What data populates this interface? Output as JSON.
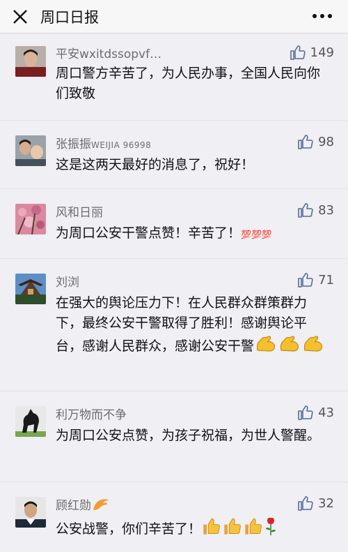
{
  "header": {
    "title": "周口日报"
  },
  "comments": [
    {
      "name": "平安wxitdssopvf…",
      "likes": "149",
      "text": "周口警方辛苦了，为人民办事，全国人民向你们致敬"
    },
    {
      "name": "张振振",
      "name_suffix": "WEIJIA 96998",
      "likes": "98",
      "text": "这是这两天最好的消息了，祝好！"
    },
    {
      "name": "风和日丽",
      "likes": "83",
      "text": "为周口公安干警点赞！辛苦了！",
      "text_tail": "💯💯💯"
    },
    {
      "name": "刘浏",
      "likes": "71",
      "text": "在强大的舆论压力下！在人民群众群策群力下，最终公安干警取得了胜利！感谢舆论平台，感谢人民群众，感谢公安干警"
    },
    {
      "name": "利万物而不争",
      "likes": "43",
      "text": "为周口公安点赞，为孩子祝福，为世人警醒。"
    },
    {
      "name": "顾红勋",
      "likes": "32",
      "text": "公安战警，你们辛苦了！"
    }
  ]
}
